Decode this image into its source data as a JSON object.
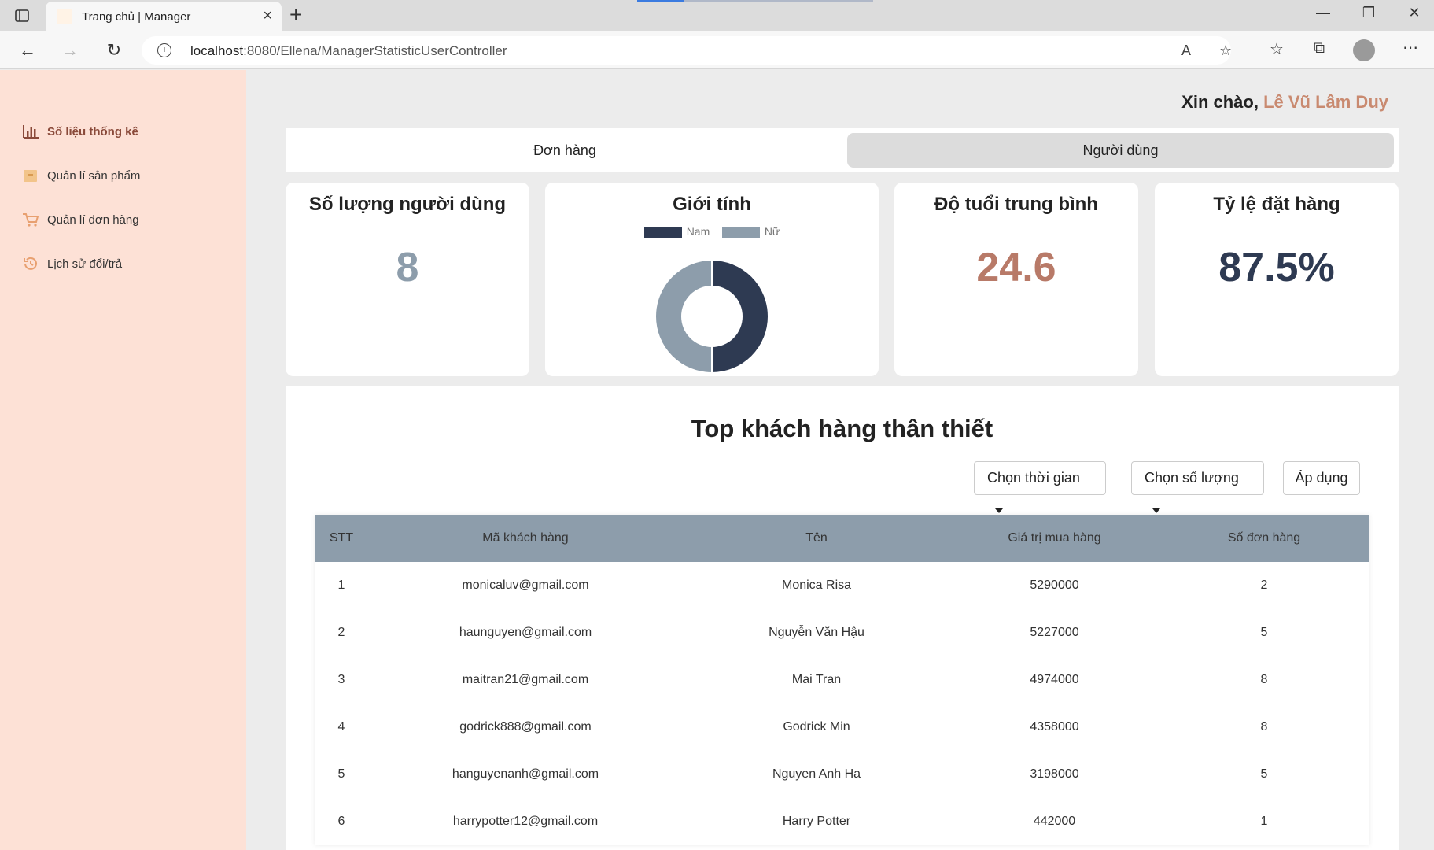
{
  "browser": {
    "tab_title": "Trang chủ | Manager",
    "url_host": "localhost",
    "url_rest": ":8080/Ellena/ManagerStatisticUserController"
  },
  "sidebar": {
    "items": [
      {
        "label": "Số liệu thống kê",
        "icon": "bar-chart-icon",
        "active": true
      },
      {
        "label": "Quản lí sản phẩm",
        "icon": "box-icon",
        "active": false
      },
      {
        "label": "Quản lí đơn hàng",
        "icon": "cart-icon",
        "active": false
      },
      {
        "label": "Lịch sử đổi/trả",
        "icon": "history-icon",
        "active": false
      }
    ]
  },
  "header": {
    "greeting": "Xin chào, ",
    "username": "Lê Vũ Lâm Duy"
  },
  "tabs": [
    {
      "label": "Đơn hàng",
      "active": false
    },
    {
      "label": "Người dùng",
      "active": true
    }
  ],
  "cards": {
    "user_count": {
      "title": "Số lượng người dùng",
      "value": "8",
      "color": "#8d9dab"
    },
    "gender": {
      "title": "Giới tính",
      "legend": [
        "Nam",
        "Nữ"
      ]
    },
    "avg_age": {
      "title": "Độ tuổi trung bình",
      "value": "24.6",
      "color": "#b87a68"
    },
    "order_rate": {
      "title": "Tỷ lệ đặt hàng",
      "value": "87.5%",
      "color": "#2e3a52"
    }
  },
  "chart_data": {
    "type": "pie",
    "title": "Giới tính",
    "categories": [
      "Nam",
      "Nữ"
    ],
    "values": [
      50,
      50
    ],
    "colors": [
      "#2e3a52",
      "#8d9dab"
    ],
    "legend": "top"
  },
  "top_customers": {
    "title": "Top khách hàng thân thiết",
    "time_select": "Chọn thời gian",
    "count_select": "Chọn số lượng",
    "apply": "Áp dụng",
    "columns": [
      "STT",
      "Mã khách hàng",
      "Tên",
      "Giá trị mua hàng",
      "Số đơn hàng"
    ],
    "rows": [
      [
        "1",
        "monicaluv@gmail.com",
        "Monica Risa",
        "5290000",
        "2"
      ],
      [
        "2",
        "haunguyen@gmail.com",
        "Nguyễn Văn Hậu",
        "5227000",
        "5"
      ],
      [
        "3",
        "maitran21@gmail.com",
        "Mai Tran",
        "4974000",
        "8"
      ],
      [
        "4",
        "godrick888@gmail.com",
        "Godrick Min",
        "4358000",
        "8"
      ],
      [
        "5",
        "hanguyenanh@gmail.com",
        "Nguyen Anh Ha",
        "3198000",
        "5"
      ],
      [
        "6",
        "harrypotter12@gmail.com",
        "Harry Potter",
        "442000",
        "1"
      ]
    ]
  }
}
